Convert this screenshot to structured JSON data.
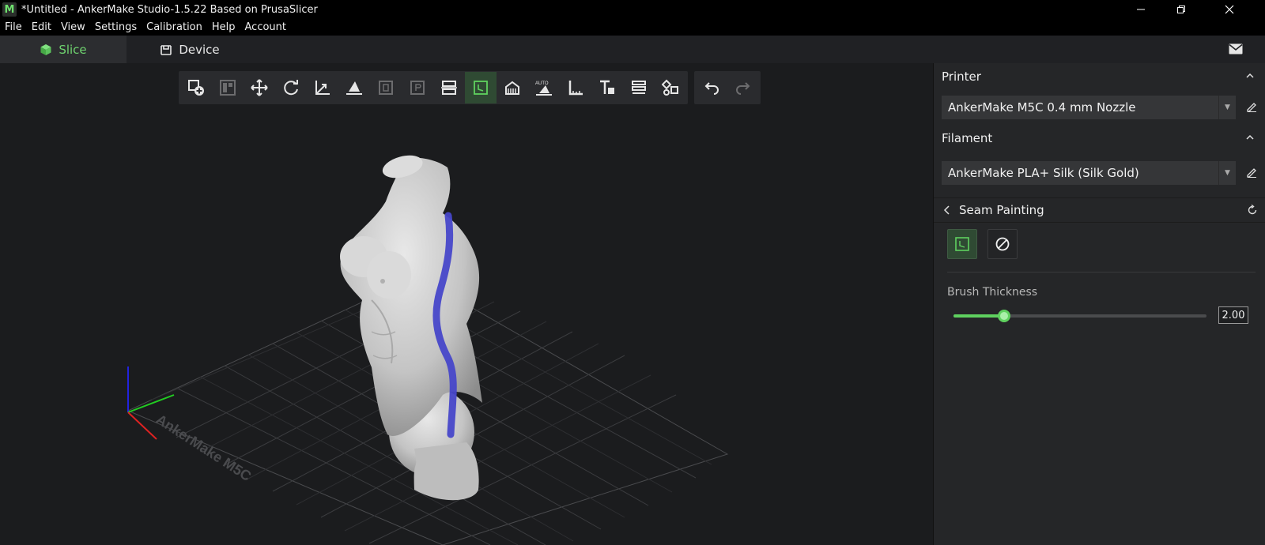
{
  "window": {
    "logo_letter": "M",
    "title": "*Untitled - AnkerMake Studio-1.5.22 Based on PrusaSlicer"
  },
  "menu": [
    "File",
    "Edit",
    "View",
    "Settings",
    "Calibration",
    "Help",
    "Account"
  ],
  "tabs": {
    "slice": "Slice",
    "device": "Device"
  },
  "toolbar": {
    "main_tools": [
      {
        "icon": "add-object-icon",
        "state": "normal"
      },
      {
        "icon": "arrange-icon",
        "state": "disabled"
      },
      {
        "icon": "move-icon",
        "state": "normal"
      },
      {
        "icon": "rotate-icon",
        "state": "normal"
      },
      {
        "icon": "scale-icon",
        "state": "normal"
      },
      {
        "icon": "place-on-face-icon",
        "state": "normal"
      },
      {
        "icon": "copy-icon",
        "state": "disabled"
      },
      {
        "icon": "paste-icon",
        "state": "disabled"
      },
      {
        "icon": "cut-icon",
        "state": "normal"
      },
      {
        "icon": "seam-painting-icon",
        "state": "active"
      },
      {
        "icon": "support-painting-icon",
        "state": "normal"
      },
      {
        "icon": "auto-orient-icon",
        "state": "normal"
      },
      {
        "icon": "measure-icon",
        "state": "normal"
      },
      {
        "icon": "text-icon",
        "state": "normal"
      },
      {
        "icon": "layers-icon",
        "state": "normal"
      },
      {
        "icon": "split-parts-icon",
        "state": "normal"
      }
    ],
    "history_tools": [
      {
        "icon": "undo-icon",
        "state": "normal"
      },
      {
        "icon": "redo-icon",
        "state": "disabled"
      }
    ]
  },
  "viewport": {
    "bed_label": "AnkerMake M5C"
  },
  "panel": {
    "printer": {
      "header": "Printer",
      "selected": "AnkerMake M5C 0.4 mm Nozzle"
    },
    "filament": {
      "header": "Filament",
      "selected": "AnkerMake PLA+ Silk (Silk Gold)"
    },
    "seam_painting": {
      "title": "Seam Painting",
      "brush_label": "Brush Thickness",
      "brush_value": "2.00",
      "brush_slider_fraction": 0.2
    }
  },
  "colors": {
    "accent": "#5fd15f",
    "seam": "#4747c9"
  }
}
